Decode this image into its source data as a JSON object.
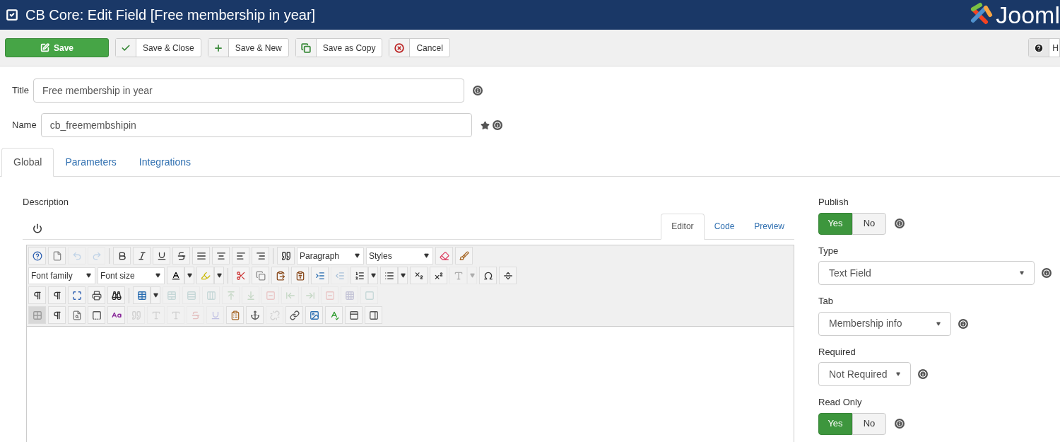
{
  "header": {
    "title": "CB Core: Edit Field [Free membership in year]",
    "logo_text": "Jooml"
  },
  "toolbar": {
    "buttons": [
      {
        "kind": "save",
        "label": "Save"
      },
      {
        "kind": "check",
        "label": "Save & Close"
      },
      {
        "kind": "plus",
        "label": "Save & New"
      },
      {
        "kind": "copy",
        "label": "Save as Copy"
      },
      {
        "kind": "cancel",
        "label": "Cancel"
      }
    ],
    "help": {
      "label": "H"
    }
  },
  "fields": [
    {
      "label": "Title",
      "value": "Free membership in year",
      "required": false
    },
    {
      "label": "Name",
      "value": "cb_freemembshipin",
      "required": true
    }
  ],
  "tabs": [
    {
      "label": "Global",
      "selected": true
    },
    {
      "label": "Parameters",
      "selected": false
    },
    {
      "label": "Integrations",
      "selected": false
    }
  ],
  "description": {
    "label": "Description",
    "editor_tabs": [
      {
        "label": "Editor",
        "selected": true
      },
      {
        "label": "Code",
        "selected": false
      },
      {
        "label": "Preview",
        "selected": false
      }
    ],
    "toolbar_rows": [
      [
        {
          "kind": "button",
          "disabled": false
        },
        {
          "kind": "button",
          "disabled": false
        },
        {
          "kind": "button",
          "disabled": true
        },
        {
          "kind": "button",
          "disabled": true
        },
        {
          "kind": "separator"
        },
        {
          "kind": "button",
          "disabled": false
        },
        {
          "kind": "button",
          "disabled": false
        },
        {
          "kind": "button",
          "disabled": false
        },
        {
          "kind": "button",
          "disabled": false
        },
        {
          "kind": "button",
          "disabled": false
        },
        {
          "kind": "button",
          "disabled": false
        },
        {
          "kind": "button",
          "disabled": false
        },
        {
          "kind": "button",
          "disabled": false
        },
        {
          "kind": "separator"
        },
        {
          "kind": "button",
          "disabled": false
        },
        {
          "kind": "select",
          "value": "Paragraph"
        },
        {
          "kind": "select",
          "value": "Styles"
        },
        {
          "kind": "button",
          "disabled": false
        },
        {
          "kind": "button",
          "disabled": false
        }
      ],
      [
        {
          "kind": "select",
          "value": "Font family"
        },
        {
          "kind": "select",
          "value": "Font size"
        },
        {
          "kind": "split",
          "disabled": false
        },
        {
          "kind": "split",
          "disabled": false
        },
        {
          "kind": "separator"
        },
        {
          "kind": "button",
          "disabled": false
        },
        {
          "kind": "button",
          "disabled": false
        },
        {
          "kind": "button",
          "disabled": false
        },
        {
          "kind": "button",
          "disabled": false
        },
        {
          "kind": "button",
          "disabled": false
        },
        {
          "kind": "button",
          "disabled": true
        },
        {
          "kind": "split",
          "disabled": false
        },
        {
          "kind": "split",
          "disabled": false
        },
        {
          "kind": "button",
          "disabled": false
        },
        {
          "kind": "button",
          "disabled": false
        },
        {
          "kind": "split",
          "disabled": true
        },
        {
          "kind": "button",
          "disabled": false
        },
        {
          "kind": "button",
          "disabled": false
        }
      ],
      [
        {
          "kind": "button",
          "disabled": false
        },
        {
          "kind": "button",
          "disabled": false
        },
        {
          "kind": "button",
          "disabled": false
        },
        {
          "kind": "button",
          "disabled": false
        },
        {
          "kind": "button",
          "disabled": false
        },
        {
          "kind": "separator"
        },
        {
          "kind": "split",
          "disabled": false
        },
        {
          "kind": "button",
          "disabled": true
        },
        {
          "kind": "button",
          "disabled": true
        },
        {
          "kind": "button",
          "disabled": true
        },
        {
          "kind": "button",
          "disabled": true
        },
        {
          "kind": "button",
          "disabled": true
        },
        {
          "kind": "button",
          "disabled": true
        },
        {
          "kind": "button",
          "disabled": true
        },
        {
          "kind": "button",
          "disabled": true
        },
        {
          "kind": "button",
          "disabled": true
        },
        {
          "kind": "button",
          "disabled": true
        },
        {
          "kind": "button",
          "disabled": true
        }
      ],
      [
        {
          "kind": "button",
          "disabled": false,
          "selected": true
        },
        {
          "kind": "button",
          "disabled": false
        },
        {
          "kind": "button",
          "disabled": false
        },
        {
          "kind": "button",
          "disabled": false
        },
        {
          "kind": "button",
          "disabled": false
        },
        {
          "kind": "button",
          "disabled": true
        },
        {
          "kind": "button",
          "disabled": true
        },
        {
          "kind": "button",
          "disabled": true
        },
        {
          "kind": "button",
          "disabled": true
        },
        {
          "kind": "button",
          "disabled": true
        },
        {
          "kind": "button",
          "disabled": false
        },
        {
          "kind": "button",
          "disabled": false
        },
        {
          "kind": "button",
          "disabled": true
        },
        {
          "kind": "button",
          "disabled": false
        },
        {
          "kind": "button",
          "disabled": false
        },
        {
          "kind": "button",
          "disabled": false
        },
        {
          "kind": "button",
          "disabled": false
        },
        {
          "kind": "button",
          "disabled": false
        }
      ]
    ]
  },
  "side": [
    {
      "kind": "toggle",
      "label": "Publish",
      "options": [
        {
          "label": "Yes",
          "selected": true
        },
        {
          "label": "No",
          "selected": false
        }
      ]
    },
    {
      "kind": "select",
      "label": "Type",
      "value": "Text Field"
    },
    {
      "kind": "select",
      "label": "Tab",
      "value": "Membership info"
    },
    {
      "kind": "select",
      "label": "Required",
      "value": "Not Required"
    },
    {
      "kind": "toggle",
      "label": "Read Only",
      "options": [
        {
          "label": "Yes",
          "selected": true
        },
        {
          "label": "No",
          "selected": false
        }
      ]
    }
  ]
}
